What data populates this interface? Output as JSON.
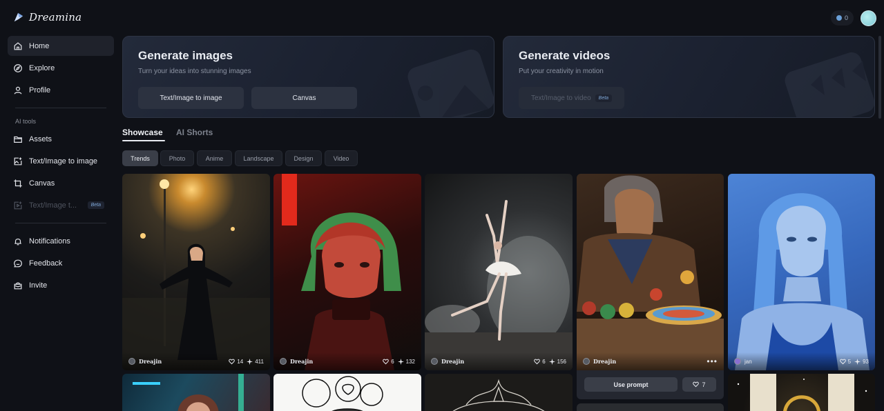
{
  "app": {
    "name": "Dreamina"
  },
  "header": {
    "credits": "0"
  },
  "sidebar": {
    "items": [
      {
        "label": "Home",
        "icon": "home-icon",
        "active": true
      },
      {
        "label": "Explore",
        "icon": "compass-icon"
      },
      {
        "label": "Profile",
        "icon": "user-icon"
      }
    ],
    "section_label": "AI tools",
    "tools": [
      {
        "label": "Assets",
        "icon": "folder-icon"
      },
      {
        "label": "Text/Image to image",
        "icon": "image-plus-icon"
      },
      {
        "label": "Canvas",
        "icon": "crop-icon"
      },
      {
        "label": "Text/Image t...",
        "icon": "video-icon",
        "disabled": true,
        "badge": "Beta"
      }
    ],
    "bottom": [
      {
        "label": "Notifications",
        "icon": "bell-icon"
      },
      {
        "label": "Feedback",
        "icon": "chat-icon"
      },
      {
        "label": "Invite",
        "icon": "gift-icon"
      }
    ]
  },
  "hero": {
    "images": {
      "title": "Generate images",
      "subtitle": "Turn your ideas into stunning images",
      "buttons": [
        "Text/Image to image",
        "Canvas"
      ]
    },
    "videos": {
      "title": "Generate videos",
      "subtitle": "Put your creativity in motion",
      "button": "Text/Image to video",
      "badge": "Beta"
    }
  },
  "tabs": [
    "Showcase",
    "AI Shorts"
  ],
  "filters": [
    "Trends",
    "Photo",
    "Anime",
    "Landscape",
    "Design",
    "Video"
  ],
  "gallery": [
    {
      "author": "Dreajin",
      "likes": "14",
      "uses": "411"
    },
    {
      "author": "Dreajin",
      "likes": "6",
      "uses": "132"
    },
    {
      "author": "Dreajin",
      "likes": "6",
      "uses": "156"
    },
    {
      "author": "Dreajin",
      "likes": "",
      "uses": ""
    },
    {
      "author": "jan",
      "likes": "5",
      "uses": "93"
    }
  ],
  "card_actions": {
    "use_prompt": "Use prompt",
    "likes": "7"
  }
}
